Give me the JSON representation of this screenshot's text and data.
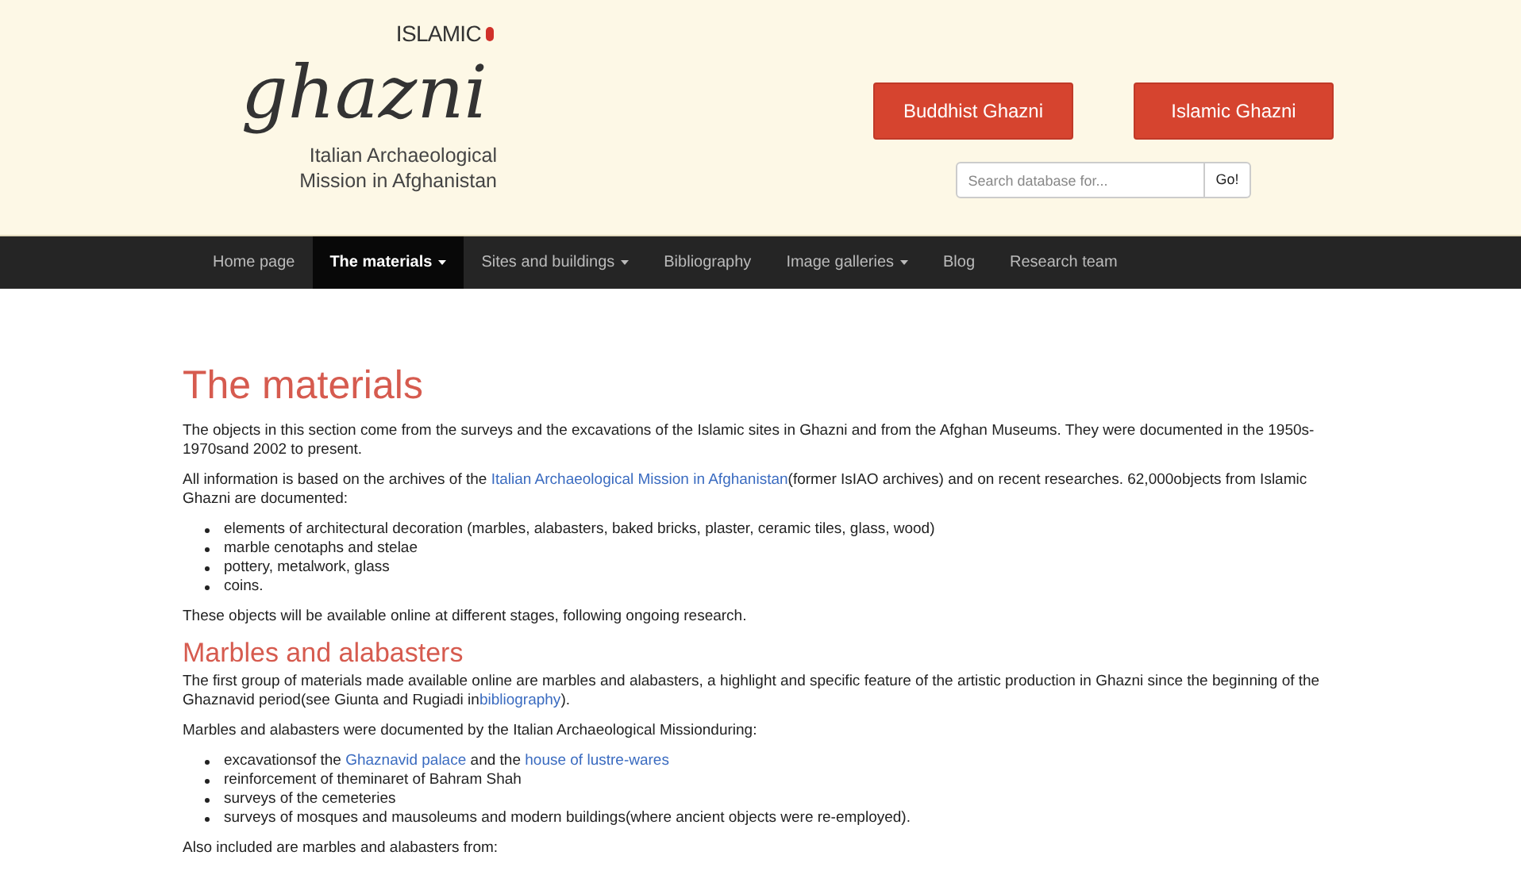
{
  "logo": {
    "over_text": "ISLAMIC",
    "main_text": "ghazni",
    "subtitle_lines": [
      "Italian Archaeological",
      "Mission in Afghanistan"
    ]
  },
  "header_buttons": [
    "Buddhist Ghazni",
    "Islamic Ghazni"
  ],
  "search": {
    "placeholder": "Search database for...",
    "button": "Go!"
  },
  "nav": [
    {
      "label": "Home page",
      "selected": false,
      "dropdown": false
    },
    {
      "label": "The materials",
      "selected": true,
      "dropdown": true
    },
    {
      "label": "Sites and buildings",
      "selected": false,
      "dropdown": true
    },
    {
      "label": "Bibliography",
      "selected": false,
      "dropdown": false
    },
    {
      "label": "Image galleries",
      "selected": false,
      "dropdown": true
    },
    {
      "label": "Blog",
      "selected": false,
      "dropdown": false
    },
    {
      "label": "Research team",
      "selected": false,
      "dropdown": false
    }
  ],
  "content": [
    {
      "kind": "h1",
      "text": "The materials"
    },
    {
      "kind": "p",
      "segments": [
        {
          "text": "The objects in this section come from the surveys and the excavations of the Islamic sites in Ghazni and from the Afghan Museums. They were documented in the 1950s-1970sand 2002 to present.",
          "link": false
        }
      ]
    },
    {
      "kind": "p",
      "segments": [
        {
          "text": "All information is based on the archives of the ",
          "link": false
        },
        {
          "text": "Italian Archaeological Mission in Afghanistan",
          "link": true
        },
        {
          "text": "(former IsIAO archives) and on recent researches. 62,000objects from Islamic Ghazni are documented:",
          "link": false
        }
      ]
    },
    {
      "kind": "ul",
      "items": [
        [
          {
            "text": "elements of architectural decoration (marbles, alabasters, baked bricks, plaster, ceramic tiles, glass, wood)",
            "link": false
          }
        ],
        [
          {
            "text": "marble cenotaphs and stelae",
            "link": false
          }
        ],
        [
          {
            "text": "pottery, metalwork, glass",
            "link": false
          }
        ],
        [
          {
            "text": "coins.",
            "link": false
          }
        ]
      ]
    },
    {
      "kind": "p",
      "segments": [
        {
          "text": "These objects will be available online at different stages, following ongoing research.",
          "link": false
        }
      ]
    },
    {
      "kind": "h2",
      "text": "Marbles and alabasters"
    },
    {
      "kind": "p",
      "segments": [
        {
          "text": "The first group of materials made available online are marbles and alabasters, a highlight and specific feature of the artistic production in Ghazni since the beginning of the Ghaznavid period(see Giunta and Rugiadi in",
          "link": false
        },
        {
          "text": "bibliography",
          "link": true
        },
        {
          "text": ").",
          "link": false
        }
      ]
    },
    {
      "kind": "p",
      "segments": [
        {
          "text": "Marbles and alabasters were documented by the Italian Archaeological Missionduring:",
          "link": false
        }
      ]
    },
    {
      "kind": "ul",
      "items": [
        [
          {
            "text": "excavationsof the ",
            "link": false
          },
          {
            "text": "Ghaznavid palace",
            "link": true
          },
          {
            "text": " and the ",
            "link": false
          },
          {
            "text": "house of lustre-wares",
            "link": true
          }
        ],
        [
          {
            "text": "reinforcement of theminaret of Bahram Shah",
            "link": false
          }
        ],
        [
          {
            "text": "surveys of the cemeteries",
            "link": false
          }
        ],
        [
          {
            "text": "surveys of mosques and mausoleums and modern buildings(where ancient objects were re-employed).",
            "link": false
          }
        ]
      ]
    },
    {
      "kind": "p",
      "segments": [
        {
          "text": "Also included are marbles and alabasters from:",
          "link": false
        }
      ]
    }
  ]
}
